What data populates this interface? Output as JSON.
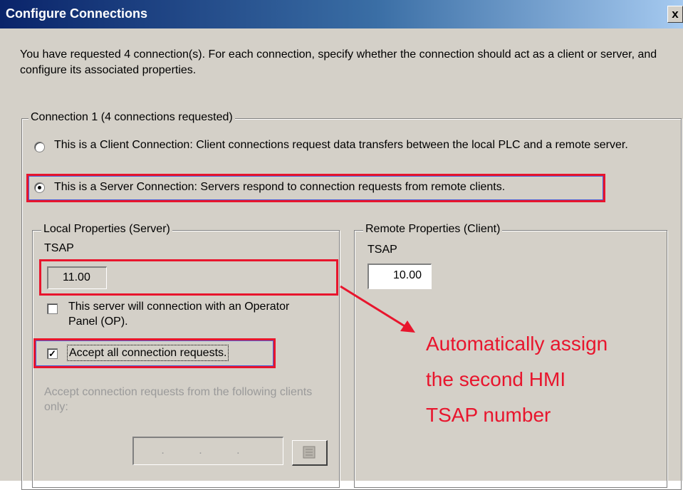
{
  "window": {
    "title": "Configure Connections",
    "close_label": "x"
  },
  "intro_text": "You have requested 4 connection(s). For each connection, specify whether the connection should act as a client or server, and configure its associated properties.",
  "connection_group": {
    "legend": "Connection 1 (4 connections requested)",
    "client_option": "This is a Client Connection: Client connections request data transfers between the local PLC and a remote server.",
    "server_option": "This is a Server Connection: Servers respond to connection requests from remote clients.",
    "selected": "server"
  },
  "local_properties": {
    "legend": "Local Properties (Server)",
    "tsap_label": "TSAP",
    "tsap_value": "11.00",
    "op_checkbox_label": "This server will connection with an Operator Panel (OP).",
    "op_checked": false,
    "accept_all_label": "Accept all connection requests.",
    "accept_all_checked": true,
    "accept_from_label": "Accept connection requests from the following clients only:",
    "ip_placeholder": ". . .",
    "address_book_icon": "address-book-icon"
  },
  "remote_properties": {
    "legend": "Remote Properties (Client)",
    "tsap_label": "TSAP",
    "tsap_value": "10.00"
  },
  "annotation": {
    "line1": "Automatically assign",
    "line2": "the second HMI",
    "line3": "TSAP number",
    "color": "#e8152d"
  }
}
